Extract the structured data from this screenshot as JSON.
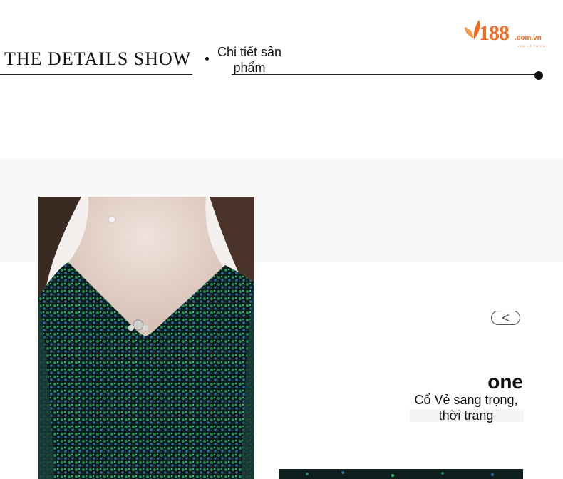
{
  "header": {
    "title": "THE DETAILS SHOW",
    "subtitle": "Chi tiết sản phẩm"
  },
  "logo": {
    "number": "188",
    "domain": ".com.vn",
    "tagline": "XEM LÀ THÍCH",
    "color": "#f26a21"
  },
  "detail": {
    "nav_prev": "<",
    "number": "one",
    "caption": "Cổ Vẻ sang trọng, thời trang"
  },
  "colors": {
    "background": "#ffffff",
    "band": "#f7f7f7",
    "dress": "#0f2220",
    "sequin_green": "#2fb36a"
  }
}
